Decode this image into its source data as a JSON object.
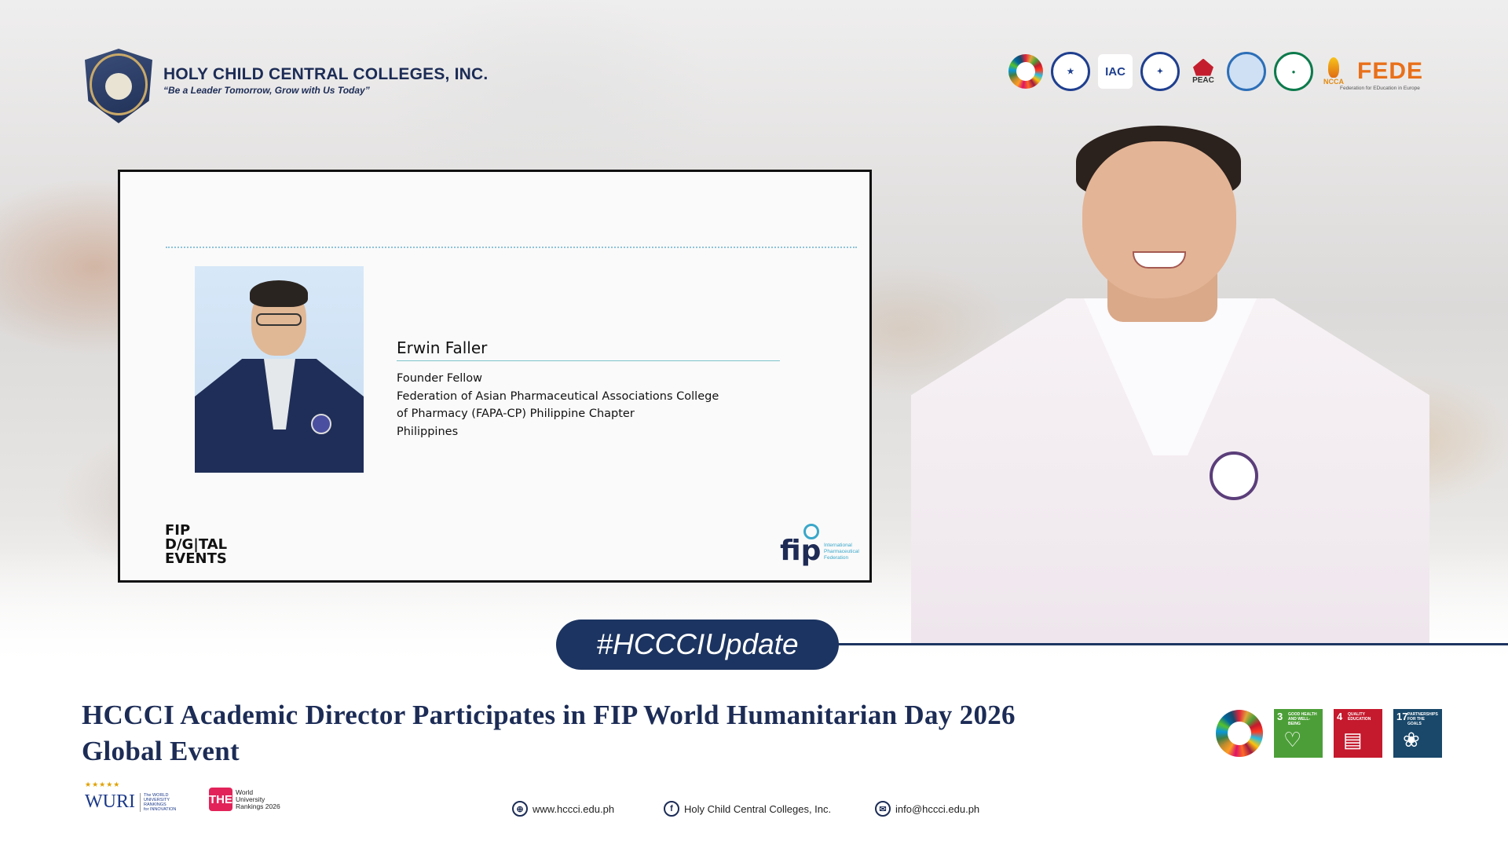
{
  "header": {
    "school_name": "HOLY CHILD CENTRAL COLLEGES, INC.",
    "motto": "“Be a Leader Tomorrow, Grow with Us Today”",
    "partner_logos": [
      "sdg-wheel-logo",
      "philippine-seal-logo",
      "iac-logo",
      "deped-seal-logo",
      "peac-logo",
      "blue-seal-logo",
      "green-seal-logo",
      "ncca-logo",
      "fede-logo"
    ],
    "peac_label": "PEAC",
    "ncca_label": "NCCA",
    "iac_label": "IAC",
    "fede_label": "FEDE",
    "fede_sub": "Federation for EDucation in Europe"
  },
  "slide": {
    "speaker_name": "Erwin Faller",
    "details_line1": "Founder Fellow",
    "details_line2": "Federation of Asian Pharmaceutical Associations College",
    "details_line3": "of Pharmacy (FAPA-CP) Philippine Chapter",
    "details_line4": "Philippines",
    "fip_digital_line1": "FIP",
    "fip_digital_line2": "D/G|TAL",
    "fip_digital_line3": "EVENTS",
    "fip_word": "fip",
    "fip_sub_line1": "International",
    "fip_sub_line2": "Pharmaceutical",
    "fip_sub_line3": "Federation"
  },
  "hashtag": "#HCCCIUpdate",
  "headline_line1": "HCCCI Academic Director Participates in FIP World Humanitarian Day 2026",
  "headline_line2": "Global Event",
  "sdgs": [
    {
      "num": "3",
      "text": "GOOD HEALTH AND WELL-BEING",
      "color": "#4c9f38",
      "icon": "heartbeat-icon"
    },
    {
      "num": "4",
      "text": "QUALITY EDUCATION",
      "color": "#c5192d",
      "icon": "book-icon"
    },
    {
      "num": "17",
      "text": "PARTNERSHIPS FOR THE GOALS",
      "color": "#19486a",
      "icon": "flower-icon"
    }
  ],
  "footer": {
    "wuri_word": "WURI",
    "wuri_sub1": "The WORLD",
    "wuri_sub2": "UNIVERSITY",
    "wuri_sub3": "RANKINGS",
    "wuri_sub4": "for INNOVATION",
    "the_box": "THE",
    "the_line1": "World",
    "the_line2": "University",
    "the_line3": "Rankings 2026",
    "website": "www.hccci.edu.ph",
    "facebook": "Holy Child Central Colleges, Inc.",
    "email": "info@hccci.edu.ph"
  },
  "colors": {
    "navy": "#1c3461",
    "brand_text": "#1c2c56",
    "accent_teal": "#7dc3c9"
  }
}
